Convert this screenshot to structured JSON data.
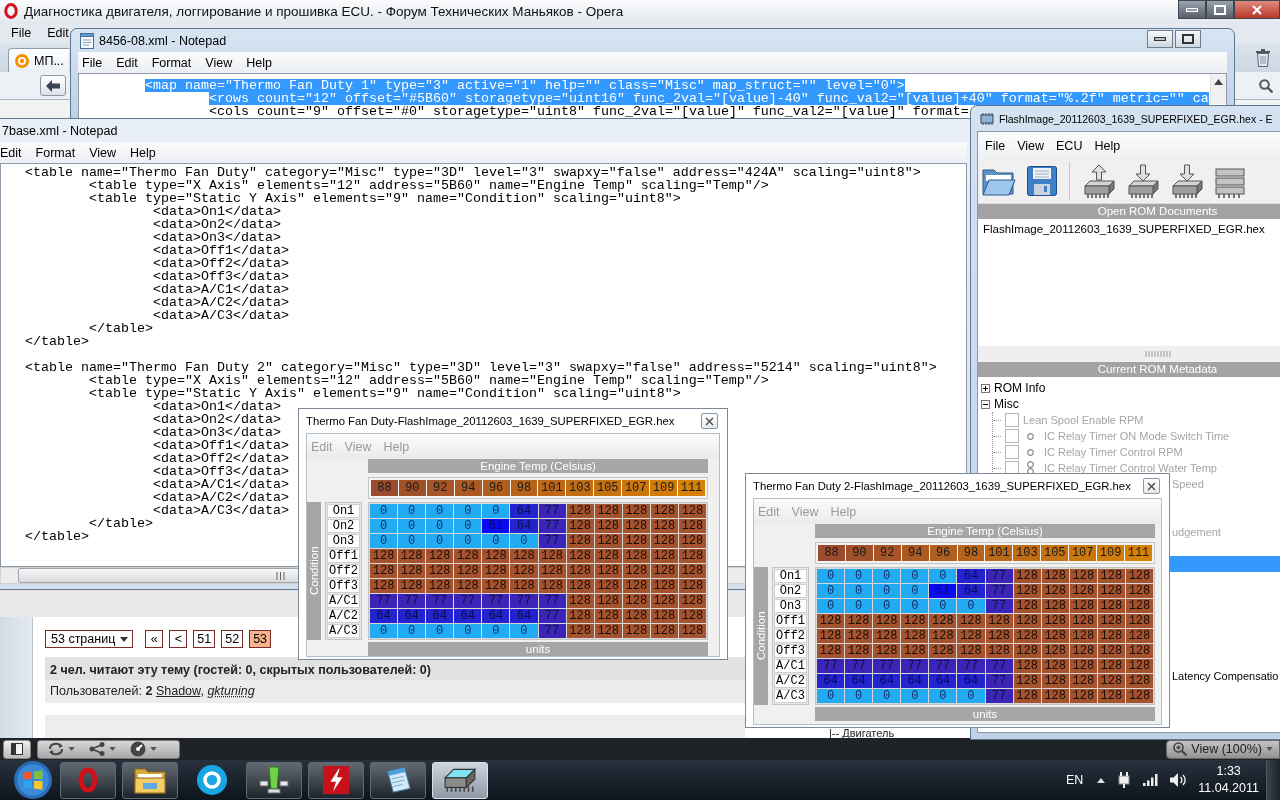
{
  "browser": {
    "title": "Диагностика двигателя, логгирование и прошивка ECU. - Форум Технических Маньяков - Opera",
    "menu": [
      "File",
      "Edit"
    ],
    "tab": {
      "label": "МП..."
    },
    "forum": {
      "page_menu": "53 страниц",
      "pages": [
        {
          "label": "«",
          "selected": false
        },
        {
          "label": "<",
          "selected": false
        },
        {
          "label": "51",
          "selected": false
        },
        {
          "label": "52",
          "selected": false
        },
        {
          "label": "53",
          "selected": true
        }
      ],
      "readers": "2 чел. читают эту тему (гостей: 0, скрытых пользователей: 0)",
      "users_label": "Пользователей:",
      "users_count": "2",
      "users": [
        {
          "name": "Shadow",
          "italic": false,
          "separator": ","
        },
        {
          "name": "gktuning",
          "italic": true
        }
      ],
      "tree_item": "|-- Двигатель"
    },
    "status_bar": {
      "zoom": "View (100%)"
    }
  },
  "notepad_back": {
    "title": "8456-08.xml - Notepad",
    "menu": [
      "File",
      "Edit",
      "Format",
      "View",
      "Help"
    ],
    "lines": [
      {
        "text": "<map name=\"Thermo Fan Duty 1\" type=\"3\" active=\"1\" help=\"\" class=\"Misc\" map_struct=\"\" level=\"0\">",
        "selected": true,
        "children": [
          {
            "text": "<rows count=\"12\" offset=\"#5B60\" storagetype=\"uint16\" func_2val=\"[value]-40\" func_val2=\"[value]+40\" format=\"%.2f\" metric=\"\" ca",
            "selected": true
          },
          {
            "text": "<cols count=\"9\" offset=\"#0\" storagetype=\"uint8\" func_2val=\"[value]\" func_val2=\"[value]\" format=",
            "selected": false
          }
        ]
      }
    ]
  },
  "notepad_front": {
    "title": "7base.xml - Notepad",
    "menu": [
      "Edit",
      "Format",
      "View",
      "Help"
    ],
    "blocks": [
      [
        {
          "text": "<table name=\"Thermo Fan Duty\" category=\"Misc\" type=\"3D\" level=\"3\" swapxy=\"false\" address=\"424A\" scaling=\"uint8\">",
          "children": [
            {
              "text": "<table type=\"X Axis\" elements=\"12\" address=\"5B60\" name=\"Engine Temp\" scaling=\"Temp\"/>"
            },
            {
              "text": "<table type=\"Static Y Axis\" elements=\"9\" name=\"Condition\" scaling=\"uint8\">",
              "children": [
                {
                  "text": "<data>On1</data>"
                },
                {
                  "text": "<data>On2</data>"
                },
                {
                  "text": "<data>On3</data>"
                },
                {
                  "text": "<data>Off1</data>"
                },
                {
                  "text": "<data>Off2</data>"
                },
                {
                  "text": "<data>Off3</data>"
                },
                {
                  "text": "<data>A/C1</data>"
                },
                {
                  "text": "<data>A/C2</data>"
                },
                {
                  "text": "<data>A/C3</data>"
                }
              ]
            },
            {
              "text": "</table>"
            }
          ]
        },
        {
          "text": "</table>"
        }
      ],
      [
        {
          "text": "<table name=\"Thermo Fan Duty 2\" category=\"Misc\" type=\"3D\" level=\"3\" swapxy=\"false\" address=\"5214\" scaling=\"uint8\">",
          "children": [
            {
              "text": "<table type=\"X Axis\" elements=\"12\" address=\"5B60\" name=\"Engine Temp\" scaling=\"Temp\"/>"
            },
            {
              "text": "<table type=\"Static Y Axis\" elements=\"9\" name=\"Condition\" scaling=\"uint8\">",
              "children": [
                {
                  "text": "<data>On1</data>"
                },
                {
                  "text": "<data>On2</data>"
                },
                {
                  "text": "<data>On3</data>"
                },
                {
                  "text": "<data>Off1</data>"
                },
                {
                  "text": "<data>Off2</data>"
                },
                {
                  "text": "<data>Off3</data>"
                },
                {
                  "text": "<data>A/C1</data>"
                },
                {
                  "text": "<data>A/C2</data>"
                },
                {
                  "text": "<data>A/C3</data>"
                }
              ]
            },
            {
              "text": "</table>"
            }
          ]
        },
        {
          "text": "</table>"
        }
      ]
    ]
  },
  "romraider": {
    "title": "FlashImage_20112603_1639_SUPERFIXED_EGR.hex - E",
    "menu": [
      "File",
      "View",
      "ECU",
      "Help"
    ],
    "documents_header": "Open ROM Documents",
    "documents": [
      {
        "label": "FlashImage_20112603_1639_SUPERFIXED_EGR.hex",
        "selected": false
      }
    ],
    "metadata_header": "Current ROM Metadata",
    "tree": [
      {
        "label": "ROM Info",
        "expanded": false
      },
      {
        "label": "Misc",
        "expanded": true,
        "children": [
          {
            "label": "Lean Spool Enable RPM",
            "kind": "plain",
            "checked": false,
            "disabled": true,
            "selected": false
          },
          {
            "label": "IC Relay Timer ON Mode Switch Time",
            "kind": "ring",
            "checked": false,
            "disabled": true,
            "selected": false
          },
          {
            "label": "IC Relay Timer Control RPM",
            "kind": "ring",
            "checked": false,
            "disabled": true,
            "selected": false
          },
          {
            "label": "IC Relay Timer Control Water Temp",
            "kind": "rings",
            "checked": false,
            "disabled": true,
            "selected": false
          },
          {
            "label": "Speed",
            "kind": "clipped",
            "disabled": true,
            "selected": false
          },
          {
            "kind": "clipped",
            "selected": false
          },
          {
            "kind": "clipped",
            "selected": false
          },
          {
            "label": "udgement",
            "kind": "clipped",
            "disabled": true,
            "selected": false
          },
          {
            "kind": "clipped",
            "selected": false
          },
          {
            "kind": "clipped",
            "selected": true
          },
          {
            "kind": "clipped",
            "selected": false
          },
          {
            "kind": "clipped",
            "selected": false
          },
          {
            "kind": "clipped",
            "selected": false
          },
          {
            "kind": "clipped",
            "selected": false
          },
          {
            "kind": "clipped",
            "selected": false
          },
          {
            "kind": "clipped",
            "selected": false
          },
          {
            "label": "Latency Compensatio",
            "kind": "clipped",
            "disabled": false,
            "selected": false
          }
        ]
      }
    ]
  },
  "table_windows": [
    {
      "title": "Thermo Fan Duty-FlashImage_20112603_1639_SUPERFIXED_EGR.hex",
      "menu": [
        "Edit",
        "View",
        "Help"
      ],
      "x_axis_title": "Engine Temp (Celsius)",
      "x_values": [
        "88",
        "90",
        "92",
        "94",
        "96",
        "98",
        "101",
        "103",
        "105",
        "107",
        "109",
        "111"
      ],
      "y_axis_title": "Condition",
      "y_values": [
        "On1",
        "On2",
        "On3",
        "Off1",
        "Off2",
        "Off3",
        "A/C1",
        "A/C2",
        "A/C3"
      ],
      "rows": [
        [
          "0",
          "0",
          "0",
          "0",
          "0",
          "64",
          "77",
          "128",
          "128",
          "128",
          "128",
          "128"
        ],
        [
          "0",
          "0",
          "0",
          "0",
          "51",
          "64",
          "77",
          "128",
          "128",
          "128",
          "128",
          "128"
        ],
        [
          "0",
          "0",
          "0",
          "0",
          "0",
          "0",
          "77",
          "128",
          "128",
          "128",
          "128",
          "128"
        ],
        [
          "128",
          "128",
          "128",
          "128",
          "128",
          "128",
          "128",
          "128",
          "128",
          "128",
          "128",
          "128"
        ],
        [
          "128",
          "128",
          "128",
          "128",
          "128",
          "128",
          "128",
          "128",
          "128",
          "128",
          "128",
          "128"
        ],
        [
          "128",
          "128",
          "128",
          "128",
          "128",
          "128",
          "128",
          "128",
          "128",
          "128",
          "128",
          "128"
        ],
        [
          "77",
          "77",
          "77",
          "77",
          "77",
          "77",
          "77",
          "128",
          "128",
          "128",
          "128",
          "128"
        ],
        [
          "64",
          "64",
          "64",
          "64",
          "64",
          "64",
          "77",
          "128",
          "128",
          "128",
          "128",
          "128"
        ],
        [
          "0",
          "0",
          "0",
          "0",
          "0",
          "0",
          "77",
          "128",
          "128",
          "128",
          "128",
          "128"
        ]
      ],
      "units": "units"
    },
    {
      "title": "Thermo Fan Duty 2-FlashImage_20112603_1639_SUPERFIXED_EGR.hex",
      "menu": [
        "Edit",
        "View",
        "Help"
      ],
      "x_axis_title": "Engine Temp (Celsius)",
      "x_values": [
        "88",
        "90",
        "92",
        "94",
        "96",
        "98",
        "101",
        "103",
        "105",
        "107",
        "109",
        "111"
      ],
      "y_axis_title": "Condition",
      "y_values": [
        "On1",
        "On2",
        "On3",
        "Off1",
        "Off2",
        "Off3",
        "A/C1",
        "A/C2",
        "A/C3"
      ],
      "rows": [
        [
          "0",
          "0",
          "0",
          "0",
          "0",
          "64",
          "77",
          "128",
          "128",
          "128",
          "128",
          "128"
        ],
        [
          "0",
          "0",
          "0",
          "0",
          "51",
          "64",
          "77",
          "128",
          "128",
          "128",
          "128",
          "128"
        ],
        [
          "0",
          "0",
          "0",
          "0",
          "0",
          "0",
          "77",
          "128",
          "128",
          "128",
          "128",
          "128"
        ],
        [
          "128",
          "128",
          "128",
          "128",
          "128",
          "128",
          "128",
          "128",
          "128",
          "128",
          "128",
          "128"
        ],
        [
          "128",
          "128",
          "128",
          "128",
          "128",
          "128",
          "128",
          "128",
          "128",
          "128",
          "128",
          "128"
        ],
        [
          "128",
          "128",
          "128",
          "128",
          "128",
          "128",
          "128",
          "128",
          "128",
          "128",
          "128",
          "128"
        ],
        [
          "77",
          "77",
          "77",
          "77",
          "77",
          "77",
          "77",
          "128",
          "128",
          "128",
          "128",
          "128"
        ],
        [
          "64",
          "64",
          "64",
          "64",
          "64",
          "64",
          "77",
          "128",
          "128",
          "128",
          "128",
          "128"
        ],
        [
          "0",
          "0",
          "0",
          "0",
          "0",
          "0",
          "77",
          "128",
          "128",
          "128",
          "128",
          "128"
        ]
      ],
      "units": "units"
    }
  ],
  "taskbar": {
    "apps": [
      {
        "kind": "browser",
        "running": true,
        "selected": false
      },
      {
        "kind": "explorer",
        "running": true,
        "selected": false
      },
      {
        "kind": "messenger",
        "running": false,
        "selected": false
      },
      {
        "kind": "widget",
        "running": true,
        "selected": false
      },
      {
        "kind": "ftp",
        "running": true,
        "selected": false
      },
      {
        "kind": "notepad",
        "running": true,
        "selected": false
      },
      {
        "kind": "flasher",
        "running": true,
        "selected": true
      }
    ],
    "language": "EN",
    "time": "1:33",
    "date": "11.04.2011"
  }
}
